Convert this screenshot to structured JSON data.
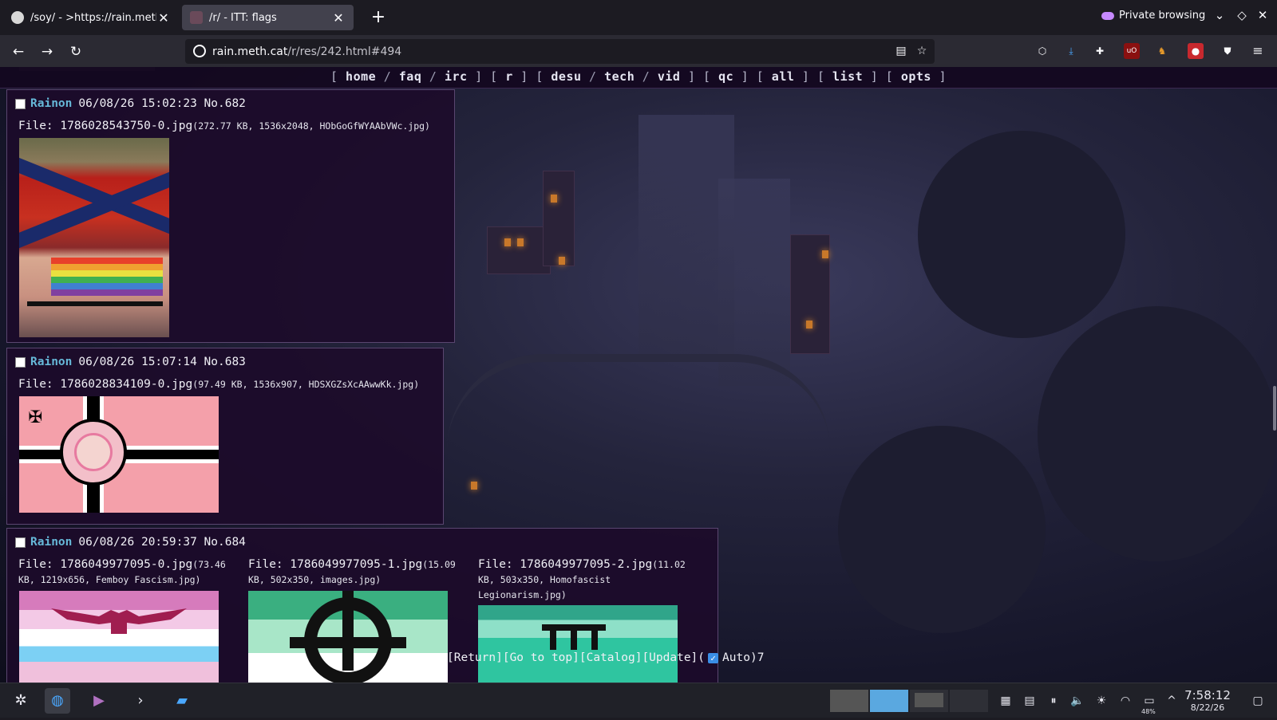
{
  "browser": {
    "tabs": [
      {
        "title": "/soy/ - >https://rain.meth.c",
        "active": false
      },
      {
        "title": "/r/ - ITT: flags",
        "active": true
      }
    ],
    "private_label": "Private browsing",
    "url_host": "rain.meth.cat",
    "url_path": "/r/res/242.html#494",
    "icons": {
      "back": "back-arrow-icon",
      "forward": "forward-arrow-icon",
      "reload": "reload-icon",
      "reader": "reader-view-icon",
      "bookmark": "bookmark-star-icon"
    }
  },
  "site_nav": {
    "groups": [
      [
        "home",
        "faq",
        "irc"
      ],
      [
        "r"
      ],
      [
        "desu",
        "tech",
        "vid"
      ],
      [
        "qc"
      ],
      [
        "all"
      ],
      [
        "list"
      ],
      [
        "opts"
      ]
    ]
  },
  "posts": [
    {
      "name": "Rainon",
      "date": "06/08/26 15:02:23",
      "no": "No.682",
      "files": [
        {
          "label": "File: ",
          "filename": "1786028543750-0.jpg",
          "meta": "(272.77 KB, 1536x2048, HObGoGfWYAAbVWc.jpg)"
        }
      ]
    },
    {
      "name": "Rainon",
      "date": "06/08/26 15:07:14",
      "no": "No.683",
      "files": [
        {
          "label": "File: ",
          "filename": "1786028834109-0.jpg",
          "meta": "(97.49 KB, 1536x907, HDSXGZsXcAAwwKk.jpg)"
        }
      ]
    },
    {
      "name": "Rainon",
      "date": "06/08/26 20:59:37",
      "no": "No.684",
      "files": [
        {
          "label": "File: ",
          "filename": "1786049977095-0.jpg",
          "meta": "(73.46 KB, 1219x656, Femboy Fascism.jpg)"
        },
        {
          "label": "File: ",
          "filename": "1786049977095-1.jpg",
          "meta": "(15.09 KB, 502x350, images.jpg)"
        },
        {
          "label": "File: ",
          "filename": "1786049977095-2.jpg",
          "meta": "(11.02 KB, 503x350, Homofascist Legionarism.jpg)"
        }
      ]
    }
  ],
  "bottom_bar": {
    "return": "[Return]",
    "top": "[Go to top]",
    "catalog": "[Catalog]",
    "update": "[Update]",
    "auto_open": "(",
    "auto_label": "Auto)",
    "counter": "7",
    "auto_checked": true
  },
  "taskbar": {
    "time": "7:58:12",
    "date": "8/22/26",
    "battery": "48%"
  }
}
